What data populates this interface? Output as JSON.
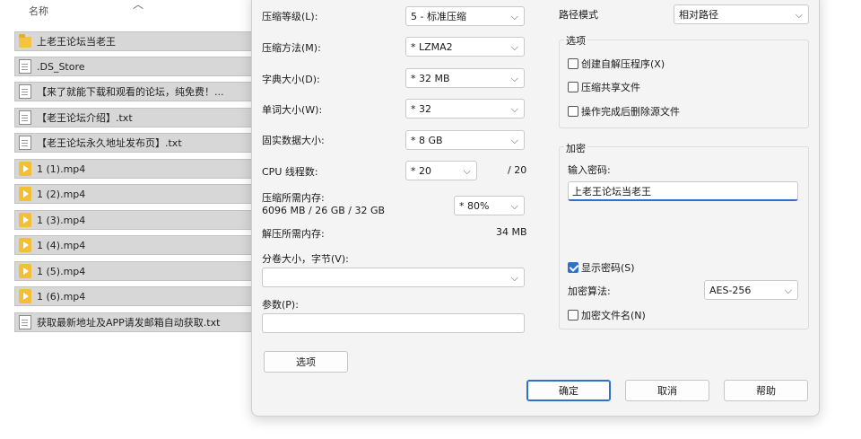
{
  "explorer": {
    "column_header": "名称",
    "files": [
      {
        "name": "上老王论坛当老王",
        "icon": "folder-icon"
      },
      {
        "name": ".DS_Store",
        "icon": "document-icon"
      },
      {
        "name": "【来了就能下载和观看的论坛，纯免费！...",
        "icon": "document-icon"
      },
      {
        "name": "【老王论坛介绍】.txt",
        "icon": "document-icon"
      },
      {
        "name": "【老王论坛永久地址发布页】.txt",
        "icon": "document-icon"
      },
      {
        "name": "1 (1).mp4",
        "icon": "video-icon"
      },
      {
        "name": "1 (2).mp4",
        "icon": "video-icon"
      },
      {
        "name": "1 (3).mp4",
        "icon": "video-icon"
      },
      {
        "name": "1 (4).mp4",
        "icon": "video-icon"
      },
      {
        "name": "1 (5).mp4",
        "icon": "video-icon"
      },
      {
        "name": "1 (6).mp4",
        "icon": "video-icon"
      },
      {
        "name": "获取最新地址及APP请发邮箱自动获取.txt",
        "icon": "document-icon"
      }
    ]
  },
  "dialog": {
    "compression_level": {
      "label": "压缩等级(L):",
      "value": "5 - 标准压缩"
    },
    "compression_method": {
      "label": "压缩方法(M):",
      "value": "* LZMA2"
    },
    "dictionary_size": {
      "label": "字典大小(D):",
      "value": "* 32 MB"
    },
    "word_size": {
      "label": "单词大小(W):",
      "value": "* 32"
    },
    "solid_block": {
      "label": "固实数据大小:",
      "value": "* 8 GB"
    },
    "cpu_threads": {
      "label": "CPU 线程数:",
      "value": "* 20",
      "max": "/ 20"
    },
    "memory_compress": {
      "label": "压缩所需内存:",
      "detail": "6096 MB / 26 GB / 32 GB",
      "value": "* 80%"
    },
    "memory_decompress": {
      "label": "解压所需内存:",
      "value": "34 MB"
    },
    "split_volume": {
      "label": "分卷大小，字节(V):",
      "value": ""
    },
    "parameters": {
      "label": "参数(P):",
      "value": ""
    },
    "options_button": "选项",
    "path_mode": {
      "label": "路径模式",
      "value": "相对路径"
    },
    "options_group": {
      "title": "选项",
      "sfx": "创建自解压程序(X)",
      "shared": "压缩共享文件",
      "delete_after": "操作完成后删除源文件"
    },
    "encryption_group": {
      "title": "加密",
      "password_label": "输入密码:",
      "password_value": "上老王论坛当老王",
      "show_password": "显示密码(S)",
      "method_label": "加密算法:",
      "method_value": "AES-256",
      "encrypt_names": "加密文件名(N)"
    },
    "buttons": {
      "ok": "确定",
      "cancel": "取消",
      "help": "帮助"
    }
  }
}
